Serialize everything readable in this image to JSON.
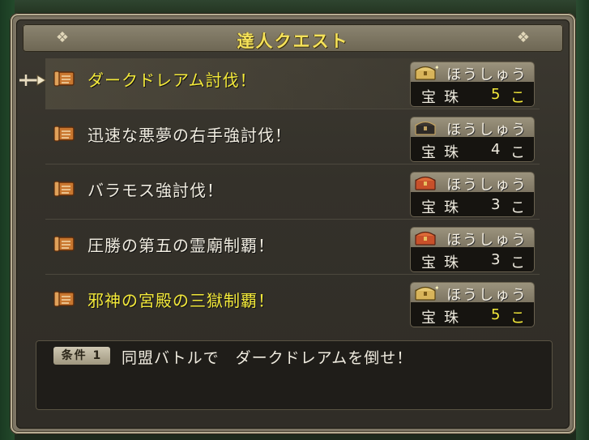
{
  "window": {
    "title": "達人クエスト"
  },
  "quests": [
    {
      "name": "ダークドレアム討伐！",
      "highlight": true,
      "reward_label": "ほうしゅう",
      "reward_item": "宝珠",
      "reward_count": "5",
      "reward_unit": "こ",
      "reward_gold": true,
      "chest": "gold-chest-icon"
    },
    {
      "name": "迅速な悪夢の右手強討伐！",
      "highlight": false,
      "reward_label": "ほうしゅう",
      "reward_item": "宝珠",
      "reward_count": "4",
      "reward_unit": "こ",
      "reward_gold": false,
      "chest": "black-chest-icon"
    },
    {
      "name": "バラモス強討伐！",
      "highlight": false,
      "reward_label": "ほうしゅう",
      "reward_item": "宝珠",
      "reward_count": "3",
      "reward_unit": "こ",
      "reward_gold": false,
      "chest": "red-chest-icon"
    },
    {
      "name": "圧勝の第五の霊廟制覇！",
      "highlight": false,
      "reward_label": "ほうしゅう",
      "reward_item": "宝珠",
      "reward_count": "3",
      "reward_unit": "こ",
      "reward_gold": false,
      "chest": "red-chest-icon"
    },
    {
      "name": "邪神の宮殿の三獄制覇！",
      "highlight": true,
      "reward_label": "ほうしゅう",
      "reward_item": "宝珠",
      "reward_count": "5",
      "reward_unit": "こ",
      "reward_gold": true,
      "chest": "gold-chest-icon"
    }
  ],
  "condition": {
    "badge": "条件 1",
    "text": "同盟バトルで　ダークドレアムを倒せ！"
  },
  "colors": {
    "highlight": "#f4ea3a",
    "text": "#f0ece0",
    "title": "#f5e25a",
    "panel": "#34312a"
  }
}
